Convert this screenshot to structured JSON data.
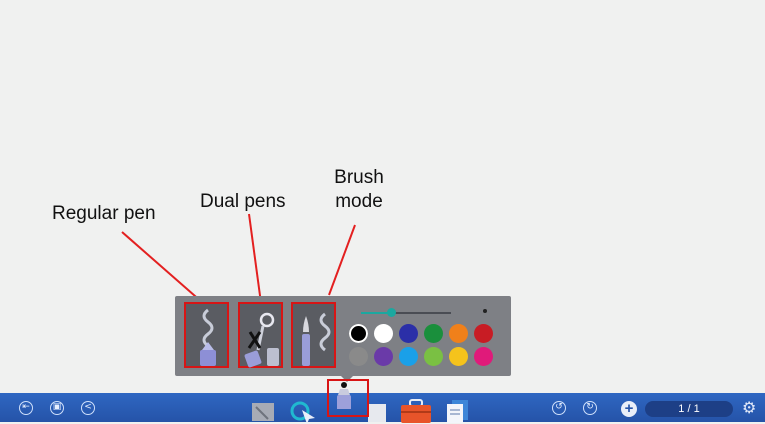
{
  "annotations": {
    "regular_pen": "Regular pen",
    "dual_pens": "Dual pens",
    "brush_mode": "Brush mode",
    "line_color": "#e32020"
  },
  "pen_panel": {
    "modes": [
      {
        "name": "regular-pen",
        "icon": "regular-pen-icon"
      },
      {
        "name": "dual-pens",
        "icon": "dual-pens-icon"
      },
      {
        "name": "brush-mode",
        "icon": "brush-icon"
      }
    ],
    "thickness_level": 0.33,
    "colors": [
      "#000000",
      "#ffffff",
      "#2b2fa8",
      "#1a8f3c",
      "#f0801a",
      "#c81c24",
      "#8a8a8a",
      "#6a3aa8",
      "#1aa0e8",
      "#7ac043",
      "#f5c31c",
      "#e01a7a"
    ],
    "selected_color": "#000000"
  },
  "taskbar": {
    "left_icons": [
      "exit-icon",
      "save-icon",
      "share-icon"
    ],
    "tools": [
      "eraser-icon",
      "select-icon",
      "pen-icon",
      "marker-icon",
      "toolbox-icon",
      "pages-icon"
    ],
    "undo_icon": "undo-icon",
    "redo_icon": "redo-icon",
    "add_page_icon": "add-page-icon",
    "add_symbol": "+",
    "page_indicator": "1 / 1",
    "settings_icon": "gear-icon"
  }
}
